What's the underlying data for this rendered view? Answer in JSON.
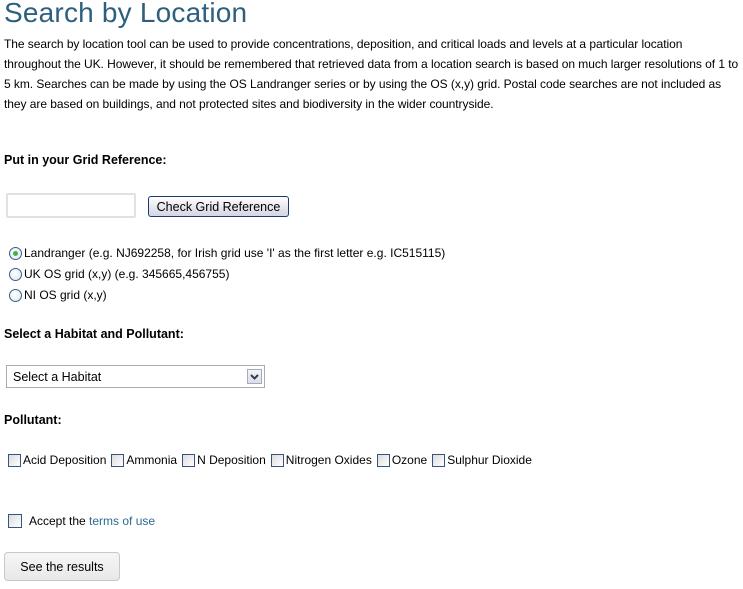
{
  "page": {
    "title": "Search by Location",
    "intro": "The search by location tool can be used to provide concentrations, deposition, and critical loads and levels at a particular location throughout the UK. However, it should be remembered that retrieved data from a location search is based on much larger resolutions of 1 to 5 km. Searches can be made by using the OS Landranger series or by using the OS (x,y) grid. Postal code searches are not included as they are based on buildings, and not protected sites and biodiversity in the wider countryside."
  },
  "grid": {
    "label": "Put in your Grid Reference:",
    "input_value": "",
    "input_placeholder": "",
    "check_button": "Check Grid Reference",
    "options": [
      {
        "label": "Landranger (e.g. NJ692258, for Irish grid use 'I' as the first letter e.g. IC515115)",
        "checked": true
      },
      {
        "label": "UK OS grid (x,y) (e.g. 345665,456755)",
        "checked": false
      },
      {
        "label": "NI OS grid (x,y)",
        "checked": false
      }
    ]
  },
  "habitat": {
    "label": "Select a Habitat and Pollutant:",
    "selected": "Select a Habitat",
    "dropdown_icon": "chevron-down-icon"
  },
  "pollutant": {
    "label": "Pollutant:",
    "options": [
      {
        "label": "Acid Deposition",
        "checked": false
      },
      {
        "label": "Ammonia",
        "checked": false
      },
      {
        "label": "N Deposition",
        "checked": false
      },
      {
        "label": "Nitrogen Oxides",
        "checked": false
      },
      {
        "label": "Ozone",
        "checked": false
      },
      {
        "label": "Sulphur Dioxide",
        "checked": false
      }
    ]
  },
  "terms": {
    "prefix": "Accept the",
    "link_text": "terms of use",
    "checked": false
  },
  "submit": {
    "label": "See the results"
  },
  "colors": {
    "title": "#2f5f7f",
    "link": "#2b6a8f",
    "radio_selected": "#3fb24b"
  }
}
